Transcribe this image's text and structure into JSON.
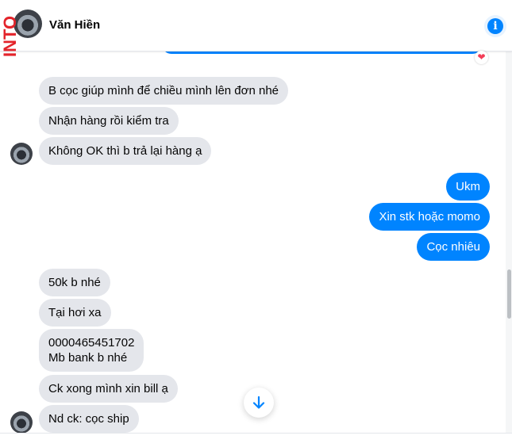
{
  "header": {
    "contact_name": "Văn Hiền",
    "info_icon": "info-icon",
    "brand_text": "INTO"
  },
  "reaction": {
    "icon": "heart-icon",
    "color": "#f33e58"
  },
  "colors": {
    "outgoing": "#0084ff",
    "incoming": "#e4e6eb"
  },
  "messages": {
    "m1": "B cọc giúp mình để chiều mình lên đơn nhé",
    "m2": "Nhận hàng rồi kiểm tra",
    "m3": "Không OK thì b trả lại hàng ạ",
    "m4": "Ukm",
    "m5": "Xin stk hoặc momo",
    "m6": "Cọc nhiêu",
    "m7": "50k b nhé",
    "m8": "Tại hơi xa",
    "m9_line1": "0000465451702",
    "m9_line2": "Mb bank b nhé",
    "m10": "Ck xong mình xin bill ạ",
    "m11": "Nd ck: cọc ship"
  },
  "scroll_button_icon": "arrow-down-icon"
}
